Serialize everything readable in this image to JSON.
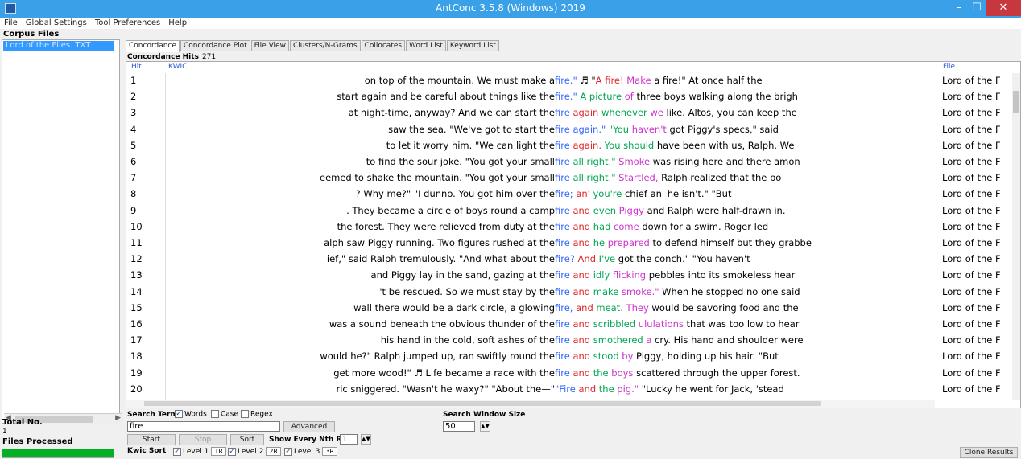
{
  "window": {
    "title": "AntConc 3.5.8 (Windows) 2019",
    "min": "–",
    "max": "☐",
    "close": "✕"
  },
  "menu": [
    "File",
    "Global Settings",
    "Tool Preferences",
    "Help"
  ],
  "left": {
    "corpus_files_label": "Corpus Files",
    "corpus_file": "Lord of the Flies. TXT",
    "total_no_label": "Total No.",
    "total_no_value": "1",
    "files_processed_label": "Files Processed",
    "progress": 1.0
  },
  "tabs": [
    "Concordance",
    "Concordance Plot",
    "File View",
    "Clusters/N-Grams",
    "Collocates",
    "Word List",
    "Keyword List"
  ],
  "hits": {
    "label": "Concordance Hits",
    "value": "271"
  },
  "columns": {
    "hit": "Hit",
    "kwic": "KWIC",
    "file": "File"
  },
  "rows": [
    {
      "n": "1",
      "left": "on top of the mountain. We must make a",
      "right": [
        {
          "t": "fire.\"",
          "c": "kw"
        },
        {
          "t": " ♬ \"",
          "c": ""
        },
        {
          "t": "A fire!",
          "c": "r"
        },
        {
          "t": " Make",
          "c": "m"
        },
        {
          "t": " a fire!\"  At once half the",
          "c": ""
        }
      ],
      "file": "Lord of the F"
    },
    {
      "n": "2",
      "left": "start again and be careful about things like the",
      "right": [
        {
          "t": "fire.\"",
          "c": "kw"
        },
        {
          "t": " A picture",
          "c": "g"
        },
        {
          "t": " of",
          "c": "m"
        },
        {
          "t": " three boys walking along the brigh",
          "c": ""
        }
      ],
      "file": "Lord of the F"
    },
    {
      "n": "3",
      "left": "at night-time, anyway? And we can start the",
      "right": [
        {
          "t": "fire",
          "c": "kw"
        },
        {
          "t": " again",
          "c": "r"
        },
        {
          "t": " whenever",
          "c": "g"
        },
        {
          "t": " we",
          "c": "m"
        },
        {
          "t": " like. Altos, you can keep the",
          "c": ""
        }
      ],
      "file": "Lord of the F"
    },
    {
      "n": "4",
      "left": "saw the sea. \"We've got to start the",
      "right": [
        {
          "t": "fire again.\"",
          "c": "kw"
        },
        {
          "t": "  \"You",
          "c": "g"
        },
        {
          "t": " haven't",
          "c": "m"
        },
        {
          "t": " got Piggy's specs,\" said",
          "c": ""
        }
      ],
      "file": "Lord of the F"
    },
    {
      "n": "5",
      "left": "to let it worry him.  \"We can light the",
      "right": [
        {
          "t": "fire",
          "c": "kw"
        },
        {
          "t": " again.",
          "c": "r"
        },
        {
          "t": " You should",
          "c": "g"
        },
        {
          "t": " have been with us, Ralph. We",
          "c": ""
        }
      ],
      "file": "Lord of the F"
    },
    {
      "n": "6",
      "left": "to find the sour joke.  \"You got your small",
      "right": [
        {
          "t": "fire",
          "c": "kw"
        },
        {
          "t": " all right.\"",
          "c": "g"
        },
        {
          "t": "  Smoke",
          "c": "m"
        },
        {
          "t": " was rising here and there amon",
          "c": ""
        }
      ],
      "file": "Lord of the F"
    },
    {
      "n": "7",
      "left": "eemed to shake the mountain.  \"You got your small",
      "right": [
        {
          "t": "fire",
          "c": "kw"
        },
        {
          "t": " all right.\"",
          "c": "g"
        },
        {
          "t": "  Startled,",
          "c": "m"
        },
        {
          "t": " Ralph realized that the bo",
          "c": ""
        }
      ],
      "file": "Lord of the F"
    },
    {
      "n": "8",
      "left": "? Why me?\"  \"I dunno. You got him over the",
      "right": [
        {
          "t": "fire;",
          "c": "kw"
        },
        {
          "t": " an'",
          "c": "r"
        },
        {
          "t": " you're",
          "c": "g"
        },
        {
          "t": " chief an' he isn't.\"  \"But",
          "c": ""
        }
      ],
      "file": "Lord of the F"
    },
    {
      "n": "9",
      "left": ". They became a circle of boys round a camp",
      "right": [
        {
          "t": "fire",
          "c": "kw"
        },
        {
          "t": " and",
          "c": "r"
        },
        {
          "t": " even",
          "c": "g"
        },
        {
          "t": " Piggy",
          "c": "m"
        },
        {
          "t": " and Ralph were half-drawn in.",
          "c": ""
        }
      ],
      "file": "Lord of the F"
    },
    {
      "n": "10",
      "left": "the forest. They were relieved from duty at the",
      "right": [
        {
          "t": "fire",
          "c": "kw"
        },
        {
          "t": " and",
          "c": "r"
        },
        {
          "t": " had",
          "c": "g"
        },
        {
          "t": " come",
          "c": "m"
        },
        {
          "t": " down for a swim. Roger led",
          "c": ""
        }
      ],
      "file": "Lord of the F"
    },
    {
      "n": "11",
      "left": "alph saw Piggy running. Two figures rushed at the",
      "right": [
        {
          "t": "fire",
          "c": "kw"
        },
        {
          "t": " and",
          "c": "r"
        },
        {
          "t": " he",
          "c": "g"
        },
        {
          "t": " prepared",
          "c": "m"
        },
        {
          "t": " to defend himself but they grabbe",
          "c": ""
        }
      ],
      "file": "Lord of the F"
    },
    {
      "n": "12",
      "left": "ief,\" said Ralph tremulously. \"And what about the",
      "right": [
        {
          "t": "fire?",
          "c": "kw"
        },
        {
          "t": " And",
          "c": "r"
        },
        {
          "t": " I've",
          "c": "g"
        },
        {
          "t": " got the conch.\"  \"You haven't",
          "c": ""
        }
      ],
      "file": "Lord of the F"
    },
    {
      "n": "13",
      "left": "and Piggy lay in the sand, gazing at the",
      "right": [
        {
          "t": "fire",
          "c": "kw"
        },
        {
          "t": " and",
          "c": "r"
        },
        {
          "t": " idly",
          "c": "g"
        },
        {
          "t": " flicking",
          "c": "m"
        },
        {
          "t": " pebbles into its smokeless hear",
          "c": ""
        }
      ],
      "file": "Lord of the F"
    },
    {
      "n": "14",
      "left": "'t be rescued. So we must stay by the",
      "right": [
        {
          "t": "fire",
          "c": "kw"
        },
        {
          "t": " and",
          "c": "r"
        },
        {
          "t": " make",
          "c": "g"
        },
        {
          "t": " smoke.\"",
          "c": "m"
        },
        {
          "t": "  When he stopped no one said",
          "c": ""
        }
      ],
      "file": "Lord of the F"
    },
    {
      "n": "15",
      "left": "wall there would be a dark circle, a glowing",
      "right": [
        {
          "t": "fire,",
          "c": "kw"
        },
        {
          "t": " and",
          "c": "r"
        },
        {
          "t": " meat.",
          "c": "g"
        },
        {
          "t": " They",
          "c": "m"
        },
        {
          "t": " would be savoring food and the",
          "c": ""
        }
      ],
      "file": "Lord of the F"
    },
    {
      "n": "16",
      "left": "was a sound beneath the obvious thunder of the",
      "right": [
        {
          "t": "fire",
          "c": "kw"
        },
        {
          "t": " and",
          "c": "r"
        },
        {
          "t": " scribbled",
          "c": "g"
        },
        {
          "t": " ululations",
          "c": "m"
        },
        {
          "t": " that was too low to hear",
          "c": ""
        }
      ],
      "file": "Lord of the F"
    },
    {
      "n": "17",
      "left": "his hand in the cold, soft ashes of the",
      "right": [
        {
          "t": "fire",
          "c": "kw"
        },
        {
          "t": " and",
          "c": "r"
        },
        {
          "t": " smothered",
          "c": "g"
        },
        {
          "t": " a",
          "c": "m"
        },
        {
          "t": " cry. His hand and shoulder were",
          "c": ""
        }
      ],
      "file": "Lord of the F"
    },
    {
      "n": "18",
      "left": "would he?\" Ralph jumped up, ran swiftly round the",
      "right": [
        {
          "t": "fire",
          "c": "kw"
        },
        {
          "t": " and",
          "c": "r"
        },
        {
          "t": " stood",
          "c": "g"
        },
        {
          "t": " by",
          "c": "m"
        },
        {
          "t": " Piggy, holding  up his hair.  \"But",
          "c": ""
        }
      ],
      "file": "Lord of the F"
    },
    {
      "n": "19",
      "left": "get more wood!\" ♬ Life became a race with the",
      "right": [
        {
          "t": "fire",
          "c": "kw"
        },
        {
          "t": " and",
          "c": "r"
        },
        {
          "t": " the",
          "c": "g"
        },
        {
          "t": " boys",
          "c": "m"
        },
        {
          "t": " scattered through the upper forest.",
          "c": ""
        }
      ],
      "file": "Lord of the F"
    },
    {
      "n": "20",
      "left": "ric sniggered.  \"Wasn't he waxy?\"  \"About the—\"",
      "right": [
        {
          "t": "\"Fire",
          "c": "kw"
        },
        {
          "t": " and",
          "c": "r"
        },
        {
          "t": " the",
          "c": "g"
        },
        {
          "t": " pig.\"",
          "c": "m"
        },
        {
          "t": "  \"Lucky he went for Jack, 'stead",
          "c": ""
        }
      ],
      "file": "Lord of the F"
    }
  ],
  "controls": {
    "search_term_label": "Search Term",
    "words_label": "Words",
    "case_label": "Case",
    "regex_label": "Regex",
    "search_value": "fire",
    "advanced_label": "Advanced",
    "window_size_label": "Search Window Size",
    "window_size_value": "50",
    "start_label": "Start",
    "stop_label": "Stop",
    "sort_label": "Sort",
    "nth_row_label": "Show Every Nth Row",
    "nth_row_value": "1",
    "kwic_sort_label": "Kwic Sort",
    "level1_label": "Level 1",
    "level1_value": "1R",
    "level2_label": "Level 2",
    "level2_value": "2R",
    "level3_label": "Level 3",
    "level3_value": "3R",
    "clone_label": "Clone Results"
  },
  "colors": {
    "titlebar": "#3aa0e8",
    "selection": "#3399ff",
    "kwic_hit": "#3366ff",
    "progress": "#06b025",
    "close": "#c7383e"
  }
}
